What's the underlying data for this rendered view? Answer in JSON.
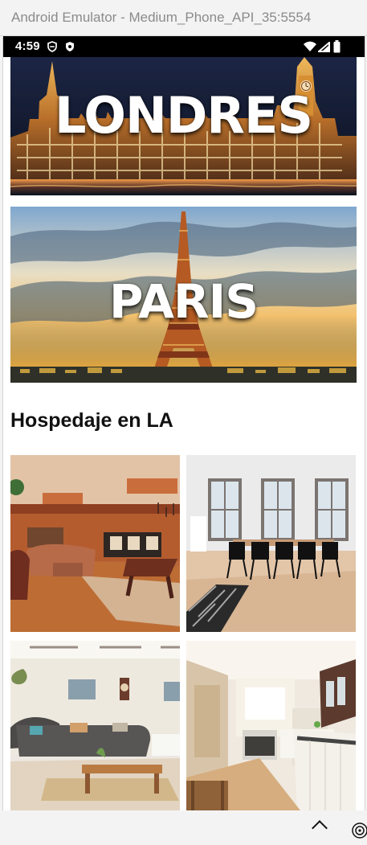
{
  "window": {
    "title": "Android Emulator - Medium_Phone_API_35:5554"
  },
  "status_bar": {
    "time": "4:59",
    "icons": [
      "shield-icon",
      "privacy-icon",
      "wifi-icon",
      "signal-icon",
      "battery-icon"
    ]
  },
  "destinations": [
    {
      "name": "LONDRES",
      "theme": "night-palace"
    },
    {
      "name": "PARIS",
      "theme": "sunset-eiffel"
    }
  ],
  "lodging": {
    "heading": "Hospedaje en LA",
    "cards": [
      {
        "image": "warm-living-room"
      },
      {
        "image": "modern-dining-room"
      },
      {
        "image": "bright-living-room"
      },
      {
        "image": "white-kitchen"
      }
    ]
  },
  "controls": {
    "chevron": "chevron-up-icon",
    "target": "target-icon"
  },
  "colors": {
    "title_text": "#8b8b8b",
    "status_bar": "#000000",
    "heading": "#111111",
    "background": "#ffffff"
  }
}
